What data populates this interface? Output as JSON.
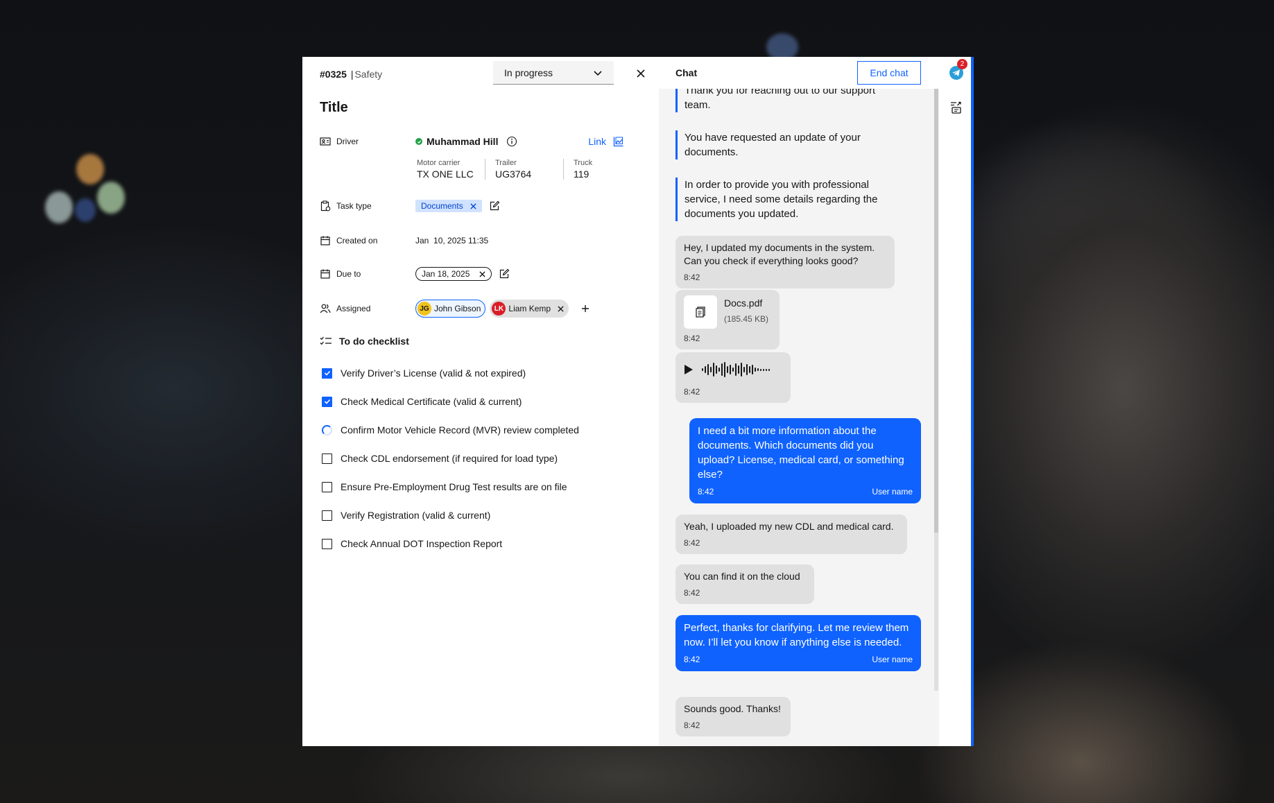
{
  "ticket": {
    "id": "#0325",
    "separator": "|",
    "category": "Safety",
    "status": "In progress",
    "title": "Title"
  },
  "fields": {
    "driver_label": "Driver",
    "driver_name": "Muhammad Hill",
    "link_label": "Link",
    "motor_carrier_label": "Motor carrier",
    "motor_carrier": "TX ONE LLC",
    "trailer_label": "Trailer",
    "trailer": "UG3764",
    "truck_label": "Truck",
    "truck": "119",
    "task_type_label": "Task type",
    "task_type": "Documents",
    "created_on_label": "Created on",
    "created_on": "Jan  10, 2025 11:35",
    "due_to_label": "Due to",
    "due_to": "Jan 18, 2025",
    "assigned_label": "Assigned",
    "assignees": [
      {
        "initials": "JG",
        "name": "John Gibson"
      },
      {
        "initials": "LK",
        "name": "Liam Kemp"
      }
    ]
  },
  "checklist": {
    "title": "To do checklist",
    "items": [
      {
        "label": "Verify Driver’s License (valid & not expired)",
        "state": "checked"
      },
      {
        "label": "Check Medical Certificate (valid & current)",
        "state": "checked"
      },
      {
        "label": "Confirm Motor Vehicle Record (MVR) review completed",
        "state": "in-progress"
      },
      {
        "label": "Check CDL endorsement (if required for load type)",
        "state": "unchecked"
      },
      {
        "label": "Ensure Pre-Employment Drug Test results are on file",
        "state": "unchecked"
      },
      {
        "label": "Verify Registration (valid & current)",
        "state": "unchecked"
      },
      {
        "label": "Check Annual DOT Inspection Report",
        "state": "unchecked"
      }
    ]
  },
  "chat": {
    "title": "Chat",
    "end_chat_label": "End chat",
    "notification_count": "2",
    "system_messages": [
      "Thank you for reaching out to our support team.",
      "You have requested an update of your documents.",
      "In order to provide you with professional service, I need some details regarding the documents you updated."
    ],
    "messages": [
      {
        "text": "Hey, I updated my documents in the system. Can you check if everything looks good?",
        "time": "8:42"
      },
      {
        "file_name": "Docs.pdf",
        "file_size": "(185.45 KB)",
        "time": "8:42"
      },
      {
        "time": "8:42"
      },
      {
        "text": "I need a bit more information about the documents. Which documents did you upload? License, medical card, or something else?",
        "time": "8:42",
        "sender": "User name"
      },
      {
        "text": "Yeah, I uploaded my new CDL and medical card.",
        "time": "8:42"
      },
      {
        "text": "You can find it on the cloud",
        "time": "8:42"
      },
      {
        "text": "Perfect, thanks for clarifying. Let me review them now. I’ll let you know if anything else is needed.",
        "time": "8:42",
        "sender": "User name"
      },
      {
        "text": "Sounds good. Thanks!",
        "time": "8:42"
      }
    ]
  }
}
